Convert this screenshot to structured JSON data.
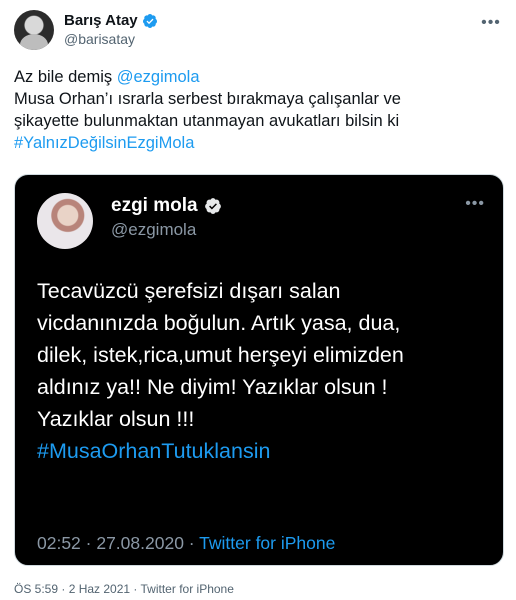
{
  "author": {
    "display_name": "Barış Atay",
    "handle": "@barisatay"
  },
  "tweet": {
    "lines": [
      {
        "prefix": "Az bile demiş ",
        "mention": "@ezgimola"
      },
      {
        "text": "Musa Orhan’ı ısrarla serbest bırakmaya çalışanlar ve"
      },
      {
        "text": "şikayette bulunmaktan utanmayan avukatları bilsin ki"
      },
      {
        "hashtag": "#YalnızDeğilsinEzgiMola"
      }
    ]
  },
  "embedded": {
    "display_name": "ezgi mola",
    "handle": "@ezgimola",
    "body_lines": [
      "Tecavüzcü şerefsizi dışarı salan",
      "vicdanınızda boğulun. Artık yasa, dua,",
      "dilek, istek,rica,umut herşeyi elimizden",
      "aldınız ya!! Ne diyim! Yazıklar olsun !",
      "Yazıklar olsun !!!"
    ],
    "hashtag": "#MusaOrhanTutuklansin",
    "timestamp": "02:52 · 27.08.2020 · ",
    "source": "Twitter for iPhone"
  },
  "footer": {
    "text": "ÖS 5:59 · 2 Haz 2021 · Twitter for iPhone"
  },
  "colors": {
    "accent": "#1d9bf0",
    "verified_badge": "#1d9bf0"
  },
  "icons": [
    "verified-badge-icon",
    "more-options-icon"
  ]
}
